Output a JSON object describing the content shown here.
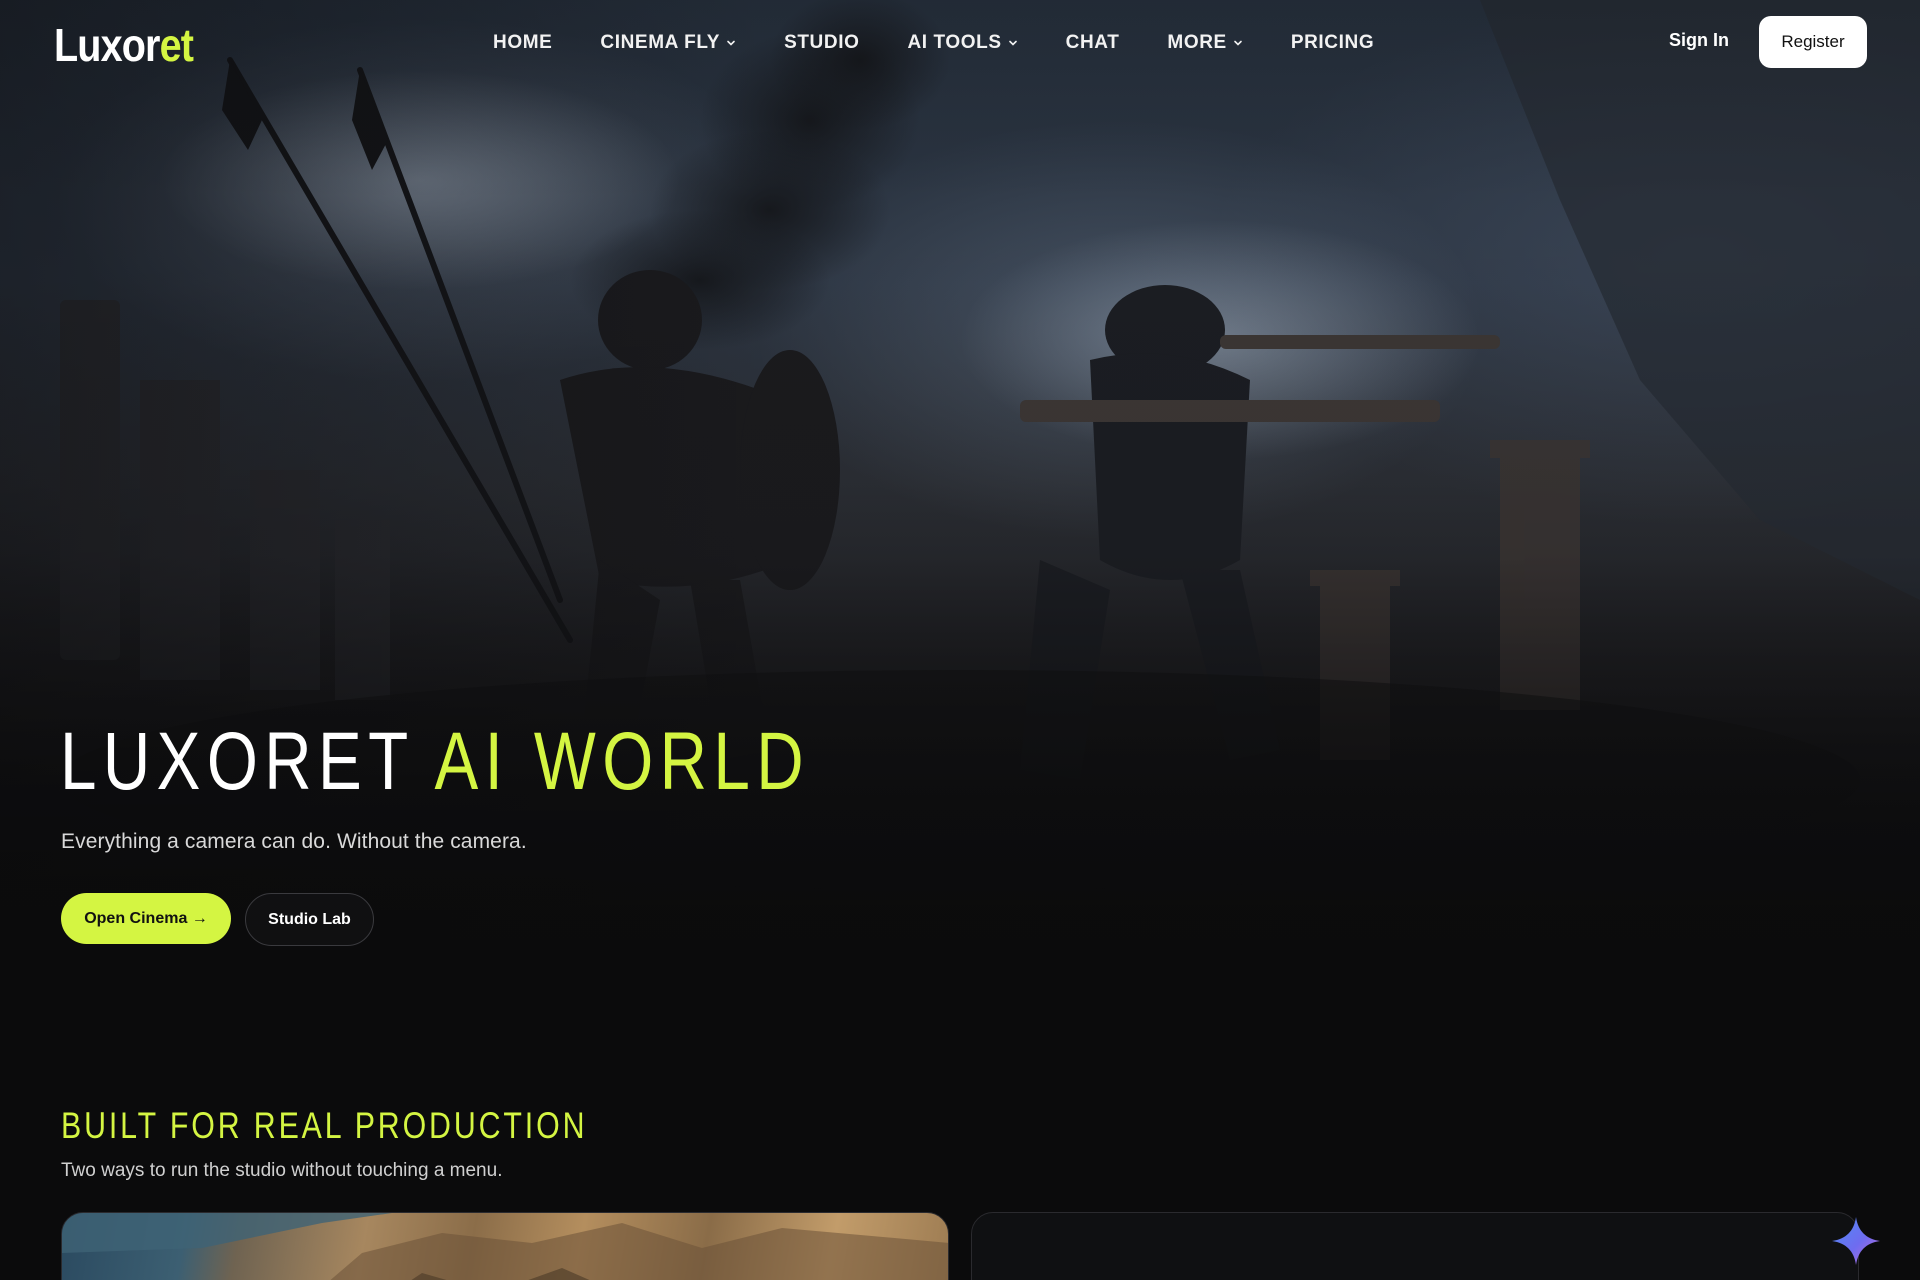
{
  "brand": {
    "logo_part1": "Luxor",
    "logo_part2": "et",
    "accent_color": "#d4f542"
  },
  "nav": {
    "items": [
      {
        "label": "HOME",
        "has_dropdown": false
      },
      {
        "label": "CINEMA FLY",
        "has_dropdown": true
      },
      {
        "label": "STUDIO",
        "has_dropdown": false
      },
      {
        "label": "AI TOOLS",
        "has_dropdown": true
      },
      {
        "label": "CHAT",
        "has_dropdown": false
      },
      {
        "label": "MORE",
        "has_dropdown": true
      },
      {
        "label": "PRICING",
        "has_dropdown": false
      }
    ],
    "sign_in": "Sign In",
    "register": "Register"
  },
  "hero": {
    "title_white": "LUXORET",
    "title_green": "AI WORLD",
    "subtitle": "Everything a camera can do. Without the camera.",
    "primary_button": "Open Cinema →",
    "secondary_button": "Studio Lab"
  },
  "section": {
    "title": "BUILT FOR REAL PRODUCTION",
    "subtitle": "Two ways to run the studio without touching a menu."
  },
  "icons": {
    "dropdown": "chevron-down-icon",
    "assistant": "sparkle-icon"
  }
}
